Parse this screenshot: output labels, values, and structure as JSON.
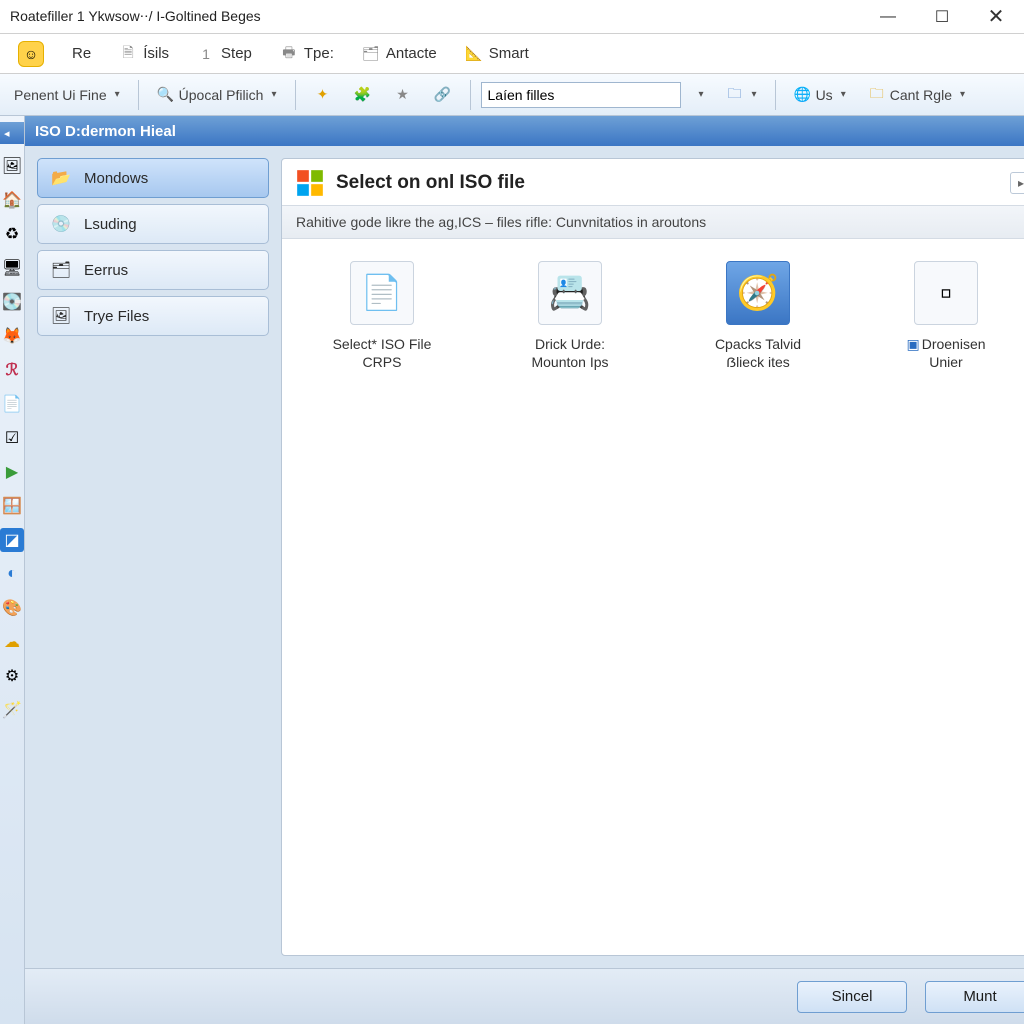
{
  "window": {
    "title": "Roatefiller 1 Ykwsow⋅⋅/ I-Goltined Beges"
  },
  "menu": {
    "items": [
      {
        "label": "Re"
      },
      {
        "label": "Ísils"
      },
      {
        "label": "Step",
        "prefix": "1"
      },
      {
        "label": "Tpe:"
      },
      {
        "label": "Antacte"
      },
      {
        "label": "Smart"
      }
    ]
  },
  "toolbar": {
    "penent": "Penent Ui Fine",
    "upocal": "Úpocal Pfilich",
    "search_value": "Laíen filles",
    "us": "Us",
    "cant": "Cant Rgle"
  },
  "section": {
    "title": "ISO D:dermon Hieal"
  },
  "sidebar": {
    "items": [
      {
        "label": "Mondows",
        "active": true,
        "icon": "📂"
      },
      {
        "label": "Lsuding",
        "active": false,
        "icon": "💿"
      },
      {
        "label": "Eerrus",
        "active": false,
        "icon": "🗂"
      },
      {
        "label": "Trye Files",
        "active": false,
        "icon": "🖼"
      }
    ]
  },
  "panel": {
    "heading": "Select on onl ISO file",
    "subtitle": "Rahitive gode likre the ag,ICS – files rifle: Cunvnitatios in aroutons",
    "tiles": [
      {
        "line1": "Select* ISO File",
        "line2": "CRPS"
      },
      {
        "line1": "Drick Urde:",
        "line2": "Mounton Ips"
      },
      {
        "line1": "Cpacks Talvid",
        "line2": "ẞlieck ites"
      },
      {
        "line1": "Droenisen",
        "line2": "Unier",
        "prefix_icon": true
      }
    ]
  },
  "footer": {
    "sincel": "Sincel",
    "munt": "Munt"
  },
  "colors": {
    "accent": "#3b76c4"
  }
}
